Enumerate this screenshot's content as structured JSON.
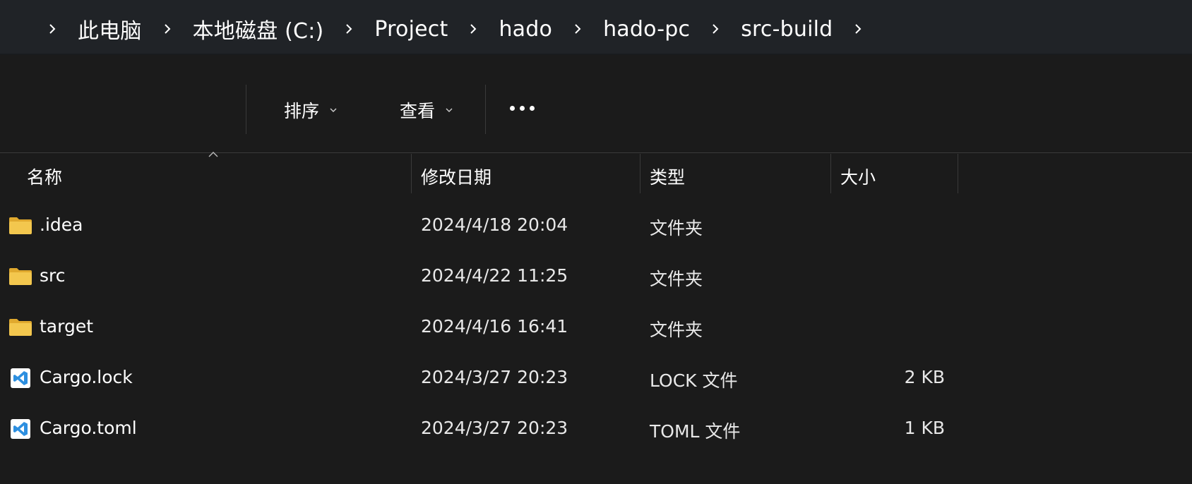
{
  "breadcrumb": {
    "items": [
      "此电脑",
      "本地磁盘 (C:)",
      "Project",
      "hado",
      "hado-pc",
      "src-build"
    ]
  },
  "toolbar": {
    "sort_label": "排序",
    "view_label": "查看"
  },
  "columns": {
    "name": "名称",
    "modified": "修改日期",
    "type": "类型",
    "size": "大小"
  },
  "files": [
    {
      "name": ".idea",
      "modified": "2024/4/18 20:04",
      "type": "文件夹",
      "size": "",
      "icon": "folder-icon"
    },
    {
      "name": "src",
      "modified": "2024/4/22 11:25",
      "type": "文件夹",
      "size": "",
      "icon": "folder-icon"
    },
    {
      "name": "target",
      "modified": "2024/4/16 16:41",
      "type": "文件夹",
      "size": "",
      "icon": "folder-icon"
    },
    {
      "name": "Cargo.lock",
      "modified": "2024/3/27 20:23",
      "type": "LOCK 文件",
      "size": "2 KB",
      "icon": "vscode-file-icon"
    },
    {
      "name": "Cargo.toml",
      "modified": "2024/3/27 20:23",
      "type": "TOML 文件",
      "size": "1 KB",
      "icon": "vscode-file-icon"
    }
  ],
  "colors": {
    "background": "#1b1b1b",
    "addressbar": "#202327",
    "folder": "#f3c74e",
    "vscode": "#2d8fe0"
  }
}
